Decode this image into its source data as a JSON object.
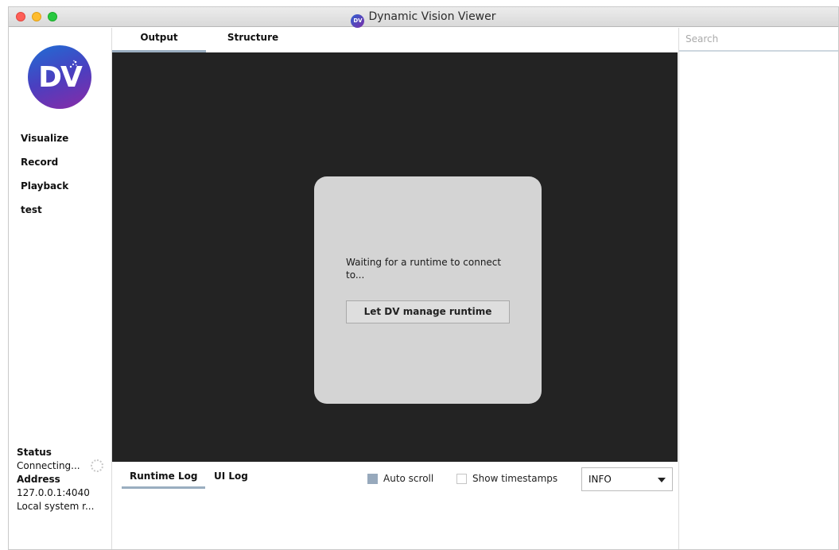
{
  "window": {
    "title": "Dynamic Vision Viewer",
    "logo_text": "DV"
  },
  "sidebar": {
    "logo_text": "DV",
    "items": [
      {
        "label": "Visualize"
      },
      {
        "label": "Record"
      },
      {
        "label": "Playback"
      },
      {
        "label": "test"
      }
    ],
    "status": {
      "status_label": "Status",
      "status_value": "Connecting...",
      "address_label": "Address",
      "address_value": "127.0.0.1:4040",
      "local_value": "Local system r..."
    }
  },
  "main": {
    "tabs": [
      {
        "label": "Output",
        "active": true
      },
      {
        "label": "Structure",
        "active": false
      }
    ],
    "dialog": {
      "message": "Waiting for a runtime to connect to...",
      "button_label": "Let DV manage runtime"
    }
  },
  "log": {
    "tabs": [
      {
        "label": "Runtime Log",
        "active": true
      },
      {
        "label": "UI Log",
        "active": false
      }
    ],
    "auto_scroll": {
      "label": "Auto scroll",
      "checked": true
    },
    "show_timestamps": {
      "label": "Show timestamps",
      "checked": false
    },
    "level": {
      "selected": "INFO"
    }
  },
  "right_panel": {
    "search_placeholder": "Search"
  },
  "colors": {
    "output_bg": "#232323",
    "dialog_bg": "#d4d4d4",
    "tab_underline": "#9aaec0",
    "logo_start": "#1f6ed4",
    "logo_end": "#8a2aa6"
  }
}
